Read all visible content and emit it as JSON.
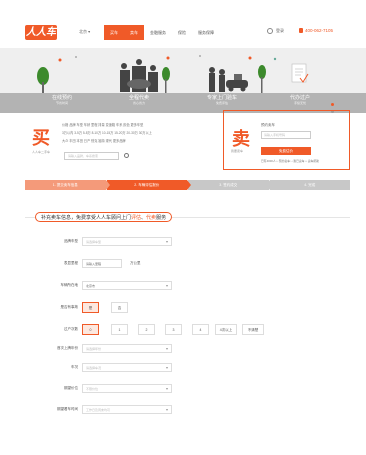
{
  "header": {
    "logo_text": "人人车",
    "city": "北京 ▾",
    "nav": [
      "买车",
      "卖车",
      "金融服务",
      "保险",
      "服务保障"
    ],
    "active_nav": [
      0,
      1
    ],
    "login": "登录",
    "phone": "400-062-7105"
  },
  "banner": {
    "items": [
      {
        "title": "在线预约",
        "sub": "节省时间"
      },
      {
        "title": "全程代卖",
        "sub": "省心省力"
      },
      {
        "title": "专家上门验车",
        "sub": "免费评估"
      },
      {
        "title": "代办过户",
        "sub": "手续无忧"
      }
    ]
  },
  "buy": {
    "char": "买",
    "sub": "人人车二手车",
    "rows": [
      "价格 品牌 车型 车龄 里程 排量 变速箱 车系 颜色 更多车型",
      "3万以内 3-5万 5-8万 8-10万 10-15万 15-20万 20-30万 30万以上",
      "大众 丰田 本田 日产 别克 福特 现代 更多品牌"
    ],
    "search_placeholder": "请输入品牌、车系搜索"
  },
  "sell": {
    "char": "卖",
    "sub": "我要卖车",
    "title": "预约卖车",
    "input_placeholder": "请输入手机号码",
    "button": "免费估价",
    "links": "已有4000人 □ 预约卖车 □ 我已卖车 □ 卖车帮助"
  },
  "steps": [
    "1. 提交卖车信息",
    "2. 车辆评估报价",
    "3. 签约成交",
    "4. 完成"
  ],
  "form": {
    "title_pre": "补充卖车信息，免费享受人人车顾问上门",
    "title_hl1": "评估",
    "title_mid": "、",
    "title_hl2": "代卖",
    "title_post": "服务",
    "fields": {
      "brand": {
        "label": "品牌车型",
        "placeholder": "请选择车型"
      },
      "mileage": {
        "label": "表显里程",
        "value": "请输入里程",
        "unit": "万公里"
      },
      "city": {
        "label": "车辆所在地",
        "value": "北京市"
      },
      "accident": {
        "label": "是否有事故",
        "options": [
          "是",
          "否"
        ]
      },
      "transfers": {
        "label": "过户次数",
        "options": [
          "0",
          "1",
          "2",
          "3",
          "4",
          "4次以上",
          "不清楚"
        ]
      },
      "reg_date": {
        "label": "首次上牌年份",
        "placeholder": "请选择年份"
      },
      "model_year": {
        "label": "车况",
        "placeholder": "请选择车况"
      },
      "plate": {
        "label": "期望价位",
        "placeholder": "不限价位"
      },
      "inspect_time": {
        "label": "期望看车时间",
        "placeholder": "工作日及周末均可"
      }
    }
  }
}
